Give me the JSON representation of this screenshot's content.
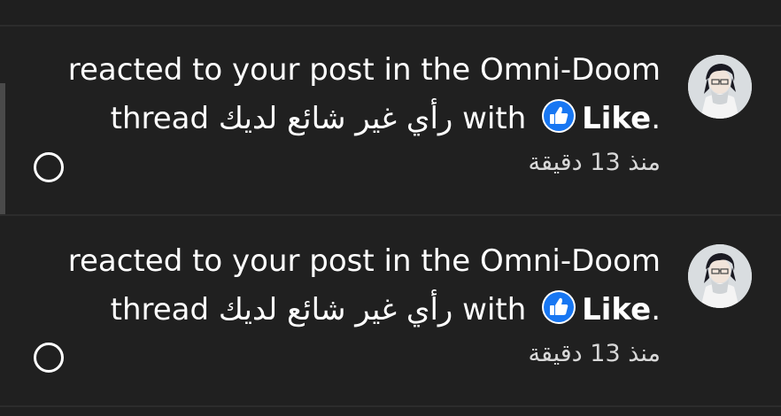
{
  "notifications": [
    {
      "line1": "reacted to your post in the Omni-Doom",
      "line2_prefix": "thread رأي غير شائع لديك with",
      "reaction": "Like",
      "period": ".",
      "time": "منذ 13 دقيقة",
      "icon": "like-thumbs-up-icon"
    },
    {
      "line1": "reacted to your post in the Omni-Doom",
      "line2_prefix": "thread رأي غير شائع لديك with",
      "reaction": "Like",
      "period": ".",
      "time": "منذ 13 دقيقة",
      "icon": "like-thumbs-up-icon"
    }
  ],
  "colors": {
    "background": "#202020",
    "like_badge": "#1877f2",
    "text": "#ffffff",
    "divider": "#2c2c2c"
  }
}
